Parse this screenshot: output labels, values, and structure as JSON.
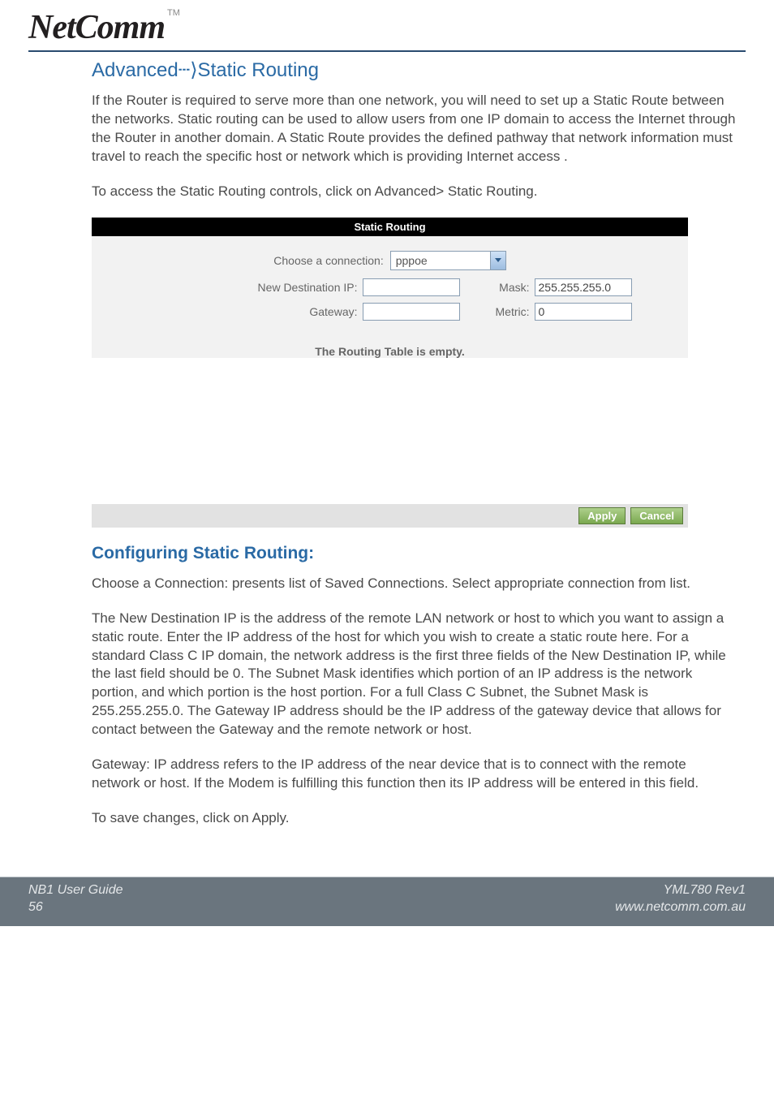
{
  "header": {
    "logo_text": "NetComm",
    "tm": "TM"
  },
  "section": {
    "title": "Advanced┄⟩Static Routing",
    "intro": "If the Router is required to serve more than one network, you will need to set up a Static Route between the networks. Static routing can be used to allow users from one IP domain to access the Internet through the Router in another domain.  A Static Route provides the defined pathway that network information must travel to reach the specific host or network which is providing Internet access .",
    "access_note": "To access the Static Routing controls, click on Advanced> Static Routing."
  },
  "panel": {
    "title": "Static Routing",
    "choose_connection_label": "Choose a connection:",
    "connection_selected": "pppoe",
    "new_dest_ip_label": "New Destination IP:",
    "new_dest_ip_value": "",
    "mask_label": "Mask:",
    "mask_value": "255.255.255.0",
    "gateway_label": "Gateway:",
    "gateway_value": "",
    "metric_label": "Metric:",
    "metric_value": "0",
    "empty_msg": "The Routing Table is empty.",
    "apply_label": "Apply",
    "cancel_label": "Cancel"
  },
  "configuring": {
    "title": "Configuring Static Routing:",
    "p1": "Choose a Connection: presents list of Saved Connections.  Select appropriate connection from list.",
    "p2": "The New Destination IP is the address of the remote LAN network or host to which you want to assign a static route. Enter the IP address of the host for which you wish to create a static route here. For a standard Class C IP domain, the network address is the first three fields of the New Destination IP, while the last field should be 0. The Subnet Mask identifies which portion of an IP address is the network portion, and which portion is the host portion. For a full Class C Subnet, the Subnet Mask is 255.255.255.0. The Gateway IP address should be the IP address of the gateway device that allows for contact between the Gateway and the remote network or host.",
    "p3": "Gateway: IP address refers to the IP address of the near device that is to connect with the remote network or host. If the Modem is fulfilling this function then its IP address will be entered in this field.",
    "p4": "To save changes, click on Apply."
  },
  "footer": {
    "guide": "NB1 User Guide",
    "page": "56",
    "rev": "YML780 Rev1",
    "url": "www.netcomm.com.au"
  }
}
